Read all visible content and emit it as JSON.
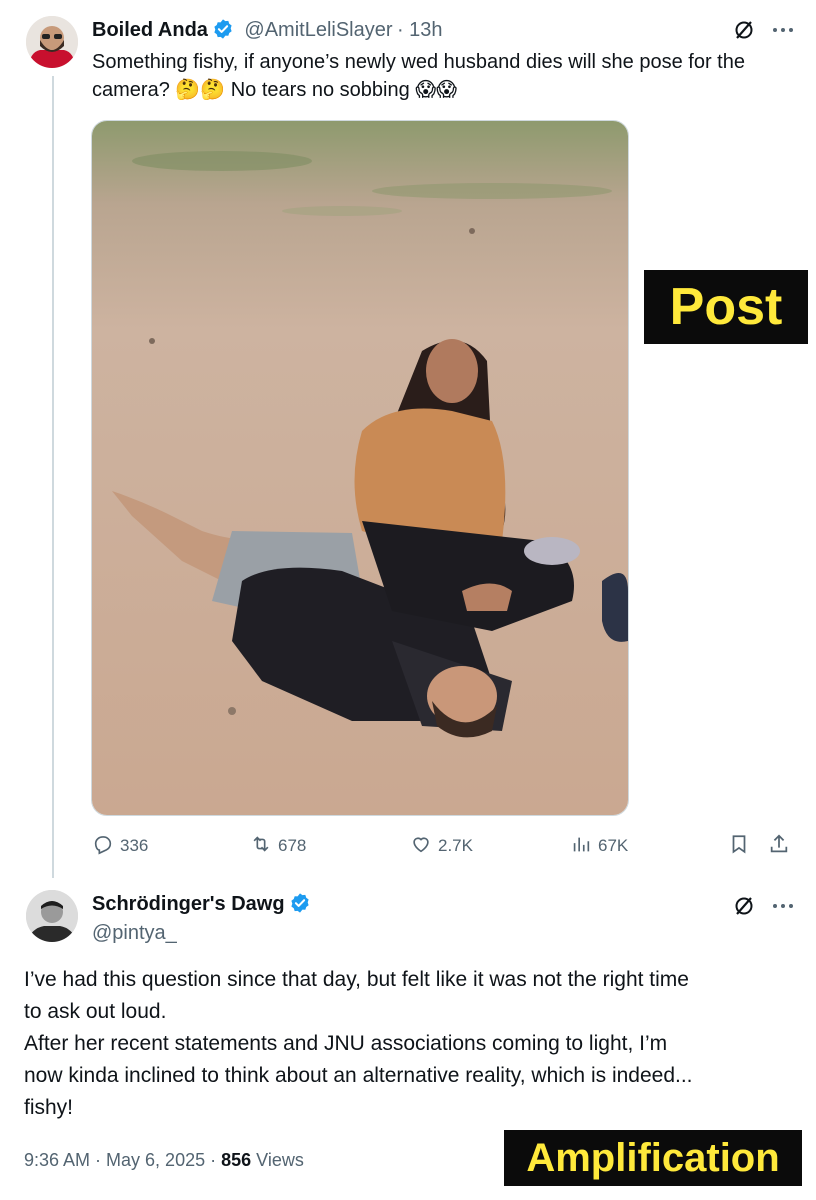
{
  "post": {
    "author_name": "Boiled Anda",
    "handle": "@AmitLeliSlayer",
    "time": "· 13h",
    "text_line1": "Something fishy, if anyone’s newly wed husband dies will she pose for the",
    "text_line2": "camera? 🤔🤔 No tears no sobbing 😱😱",
    "photo_icon": "photo-couple-on-ground",
    "stats": {
      "replies": "336",
      "reposts": "678",
      "likes": "2.7K",
      "views": "67K"
    }
  },
  "reply": {
    "author_name": "Schrödinger's Dawg",
    "handle": "@pintya_",
    "text_line1": "I’ve had this question since that day, but felt like it was not the right time",
    "text_line2": "to ask out loud.",
    "text_line3": "After her recent statements and JNU associations coming to light, I’m",
    "text_line4": "now kinda inclined to think about an alternative reality, which is indeed...",
    "text_line5": "fishy!",
    "timestamp": "9:36 AM · May 6, 2025 ·",
    "views_count": "856",
    "views_label": "Views"
  },
  "labels": {
    "post": "Post",
    "amplification": "Amplification"
  },
  "colors": {
    "verified": "#1d9bf0",
    "label_bg": "#0b0b0b",
    "label_text": "#ffe93b",
    "secondary_text": "#536471"
  }
}
